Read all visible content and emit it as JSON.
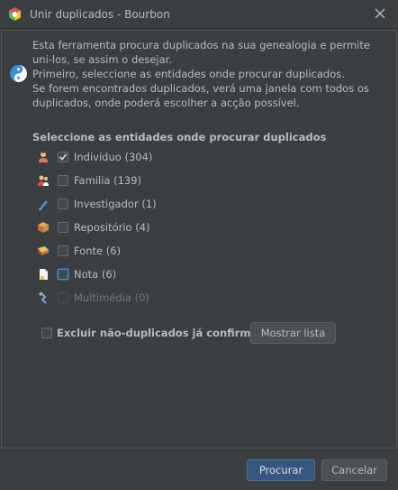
{
  "window": {
    "title": "Unir duplicados - Bourbon"
  },
  "description": {
    "line1": "Esta ferramenta procura duplicados na sua genealogia e permite uni-los, se assim o desejar.",
    "line2": "Primeiro, seleccione as entidades onde procurar duplicados.",
    "line3": "Se forem encontrados duplicados, verá uma janela com todos os duplicados, onde poderá escolher a acção possível."
  },
  "section_title": "Seleccione as entidades onde procurar duplicados",
  "entities": [
    {
      "label": "Indivíduo (304)",
      "checked": true,
      "enabled": true,
      "icon": "person-icon"
    },
    {
      "label": "Família (139)",
      "checked": false,
      "enabled": true,
      "icon": "family-icon"
    },
    {
      "label": "Investigador (1)",
      "checked": false,
      "enabled": true,
      "icon": "pen-icon"
    },
    {
      "label": "Repositório (4)",
      "checked": false,
      "enabled": true,
      "icon": "box-icon"
    },
    {
      "label": "Fonte (6)",
      "checked": false,
      "enabled": true,
      "icon": "book-icon"
    },
    {
      "label": "Nota (6)",
      "checked": false,
      "enabled": true,
      "icon": "note-icon"
    },
    {
      "label": "Multimédia (0)",
      "checked": false,
      "enabled": false,
      "icon": "media-icon"
    }
  ],
  "exclude": {
    "label": "Excluir não-duplicados já confirmados",
    "checked": false
  },
  "buttons": {
    "show_list": "Mostrar lista",
    "search": "Procurar",
    "cancel": "Cancelar"
  },
  "colors": {
    "background": "#3c3f41",
    "primary_button": "#365880",
    "text": "#bbbbbb"
  }
}
